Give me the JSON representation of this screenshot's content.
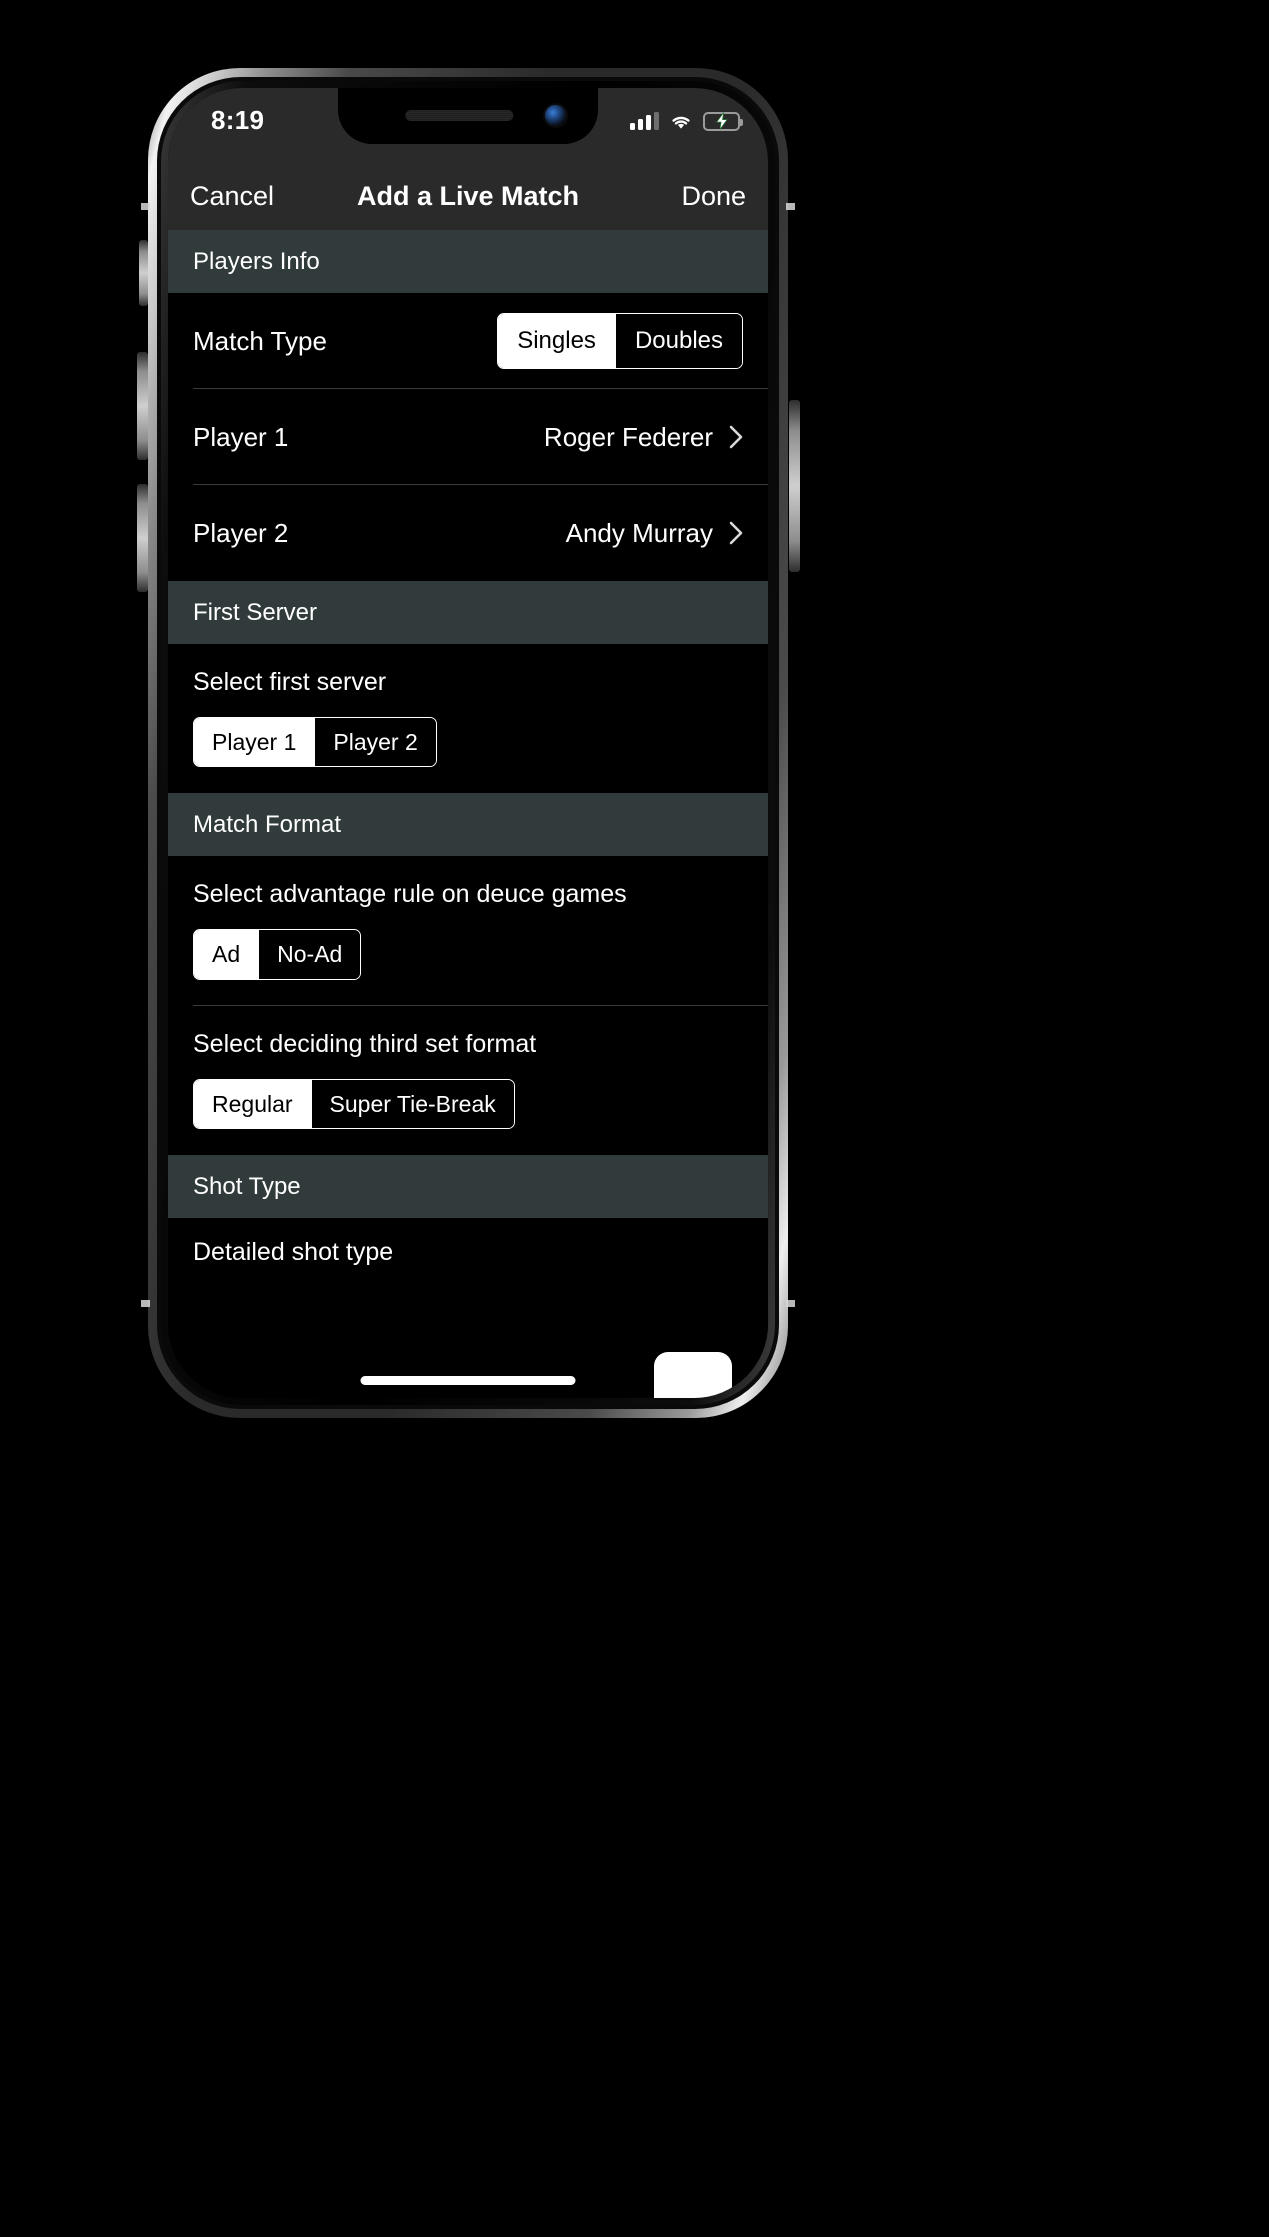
{
  "status_bar": {
    "time": "8:19",
    "signal_icon": "cellular-signal-icon",
    "signal_bars_filled": 3,
    "signal_bars_total": 4,
    "wifi_icon": "wifi-icon",
    "battery_icon": "battery-charging-icon",
    "battery_color": "#4cd964"
  },
  "nav": {
    "cancel_label": "Cancel",
    "title": "Add a Live Match",
    "done_label": "Done"
  },
  "sections": {
    "players_info": {
      "header": "Players Info",
      "match_type": {
        "label": "Match Type",
        "options": [
          "Singles",
          "Doubles"
        ],
        "selected": "Singles"
      },
      "player1": {
        "label": "Player 1",
        "value": "Roger Federer",
        "chevron": "chevron-right-icon"
      },
      "player2": {
        "label": "Player 2",
        "value": "Andy Murray",
        "chevron": "chevron-right-icon"
      }
    },
    "first_server": {
      "header": "First Server",
      "prompt": "Select first server",
      "options": [
        "Player 1",
        "Player 2"
      ],
      "selected": "Player 1"
    },
    "match_format": {
      "header": "Match Format",
      "advantage": {
        "prompt": "Select advantage rule on deuce games",
        "options": [
          "Ad",
          "No-Ad"
        ],
        "selected": "Ad"
      },
      "third_set": {
        "prompt": "Select deciding third set format",
        "options": [
          "Regular",
          "Super Tie-Break"
        ],
        "selected": "Regular"
      }
    },
    "shot_type": {
      "header": "Shot Type",
      "cut_off_text": "Detailed shot type"
    }
  },
  "colors": {
    "section_header_bg": "#313b3b",
    "nav_bg": "#2a2a2a",
    "screen_bg": "#000000",
    "text": "#ffffff"
  }
}
